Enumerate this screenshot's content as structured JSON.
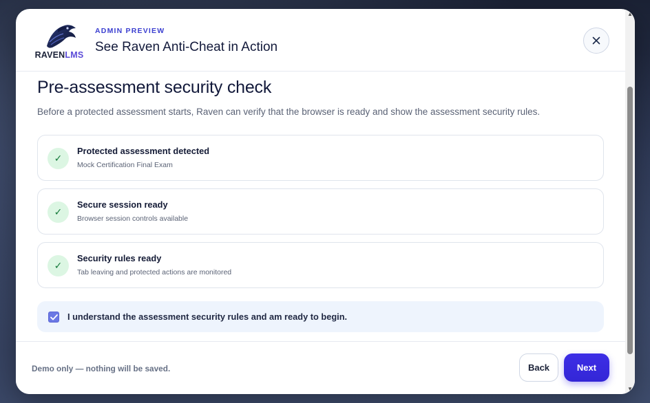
{
  "header": {
    "logo_primary": "RAVEN",
    "logo_secondary": "LMS",
    "eyebrow": "ADMIN PREVIEW",
    "title": "See Raven Anti-Cheat in Action"
  },
  "content": {
    "heading": "Pre-assessment security check",
    "lead": "Before a protected assessment starts, Raven can verify that the browser is ready and show the assessment security rules.",
    "checks": [
      {
        "title": "Protected assessment detected",
        "subtitle": "Mock Certification Final Exam",
        "status_icon": "check-icon"
      },
      {
        "title": "Secure session ready",
        "subtitle": "Browser session controls available",
        "status_icon": "check-icon"
      },
      {
        "title": "Security rules ready",
        "subtitle": "Tab leaving and protected actions are monitored",
        "status_icon": "check-icon"
      }
    ],
    "agreement": {
      "label": "I understand the assessment security rules and am ready to begin.",
      "checked": true
    }
  },
  "footer": {
    "note": "Demo only — nothing will be saved.",
    "back_label": "Back",
    "next_label": "Next"
  },
  "colors": {
    "accent": "#3b2ee6",
    "success_bg": "#dcf6e3",
    "success_fg": "#157a3a",
    "agree_bg": "#eef4fd"
  },
  "icons": {
    "check_glyph": "✓",
    "up_arrow": "▲",
    "down_arrow": "▼"
  }
}
